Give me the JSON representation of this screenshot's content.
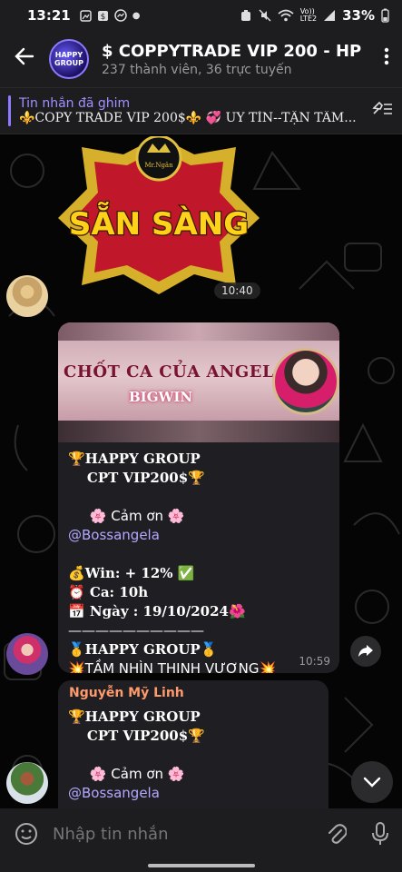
{
  "status_bar": {
    "time": "13:21",
    "network": "Vo))\nLTE2",
    "battery": "33%"
  },
  "header": {
    "title": "$ COPPYTRADE VIP 200 - HP",
    "subtitle": "237 thành viên, 36 trực tuyến",
    "avatar_text_1": "HAPPY",
    "avatar_text_2": "GROUP"
  },
  "pinned": {
    "label": "Tin nhắn đã ghim",
    "message": "⚜️COPY TRADE VIP 200$⚜️     💞 UY TÍN--TẬN TÂM..."
  },
  "sticker": {
    "text": "SẴN SÀNG",
    "sign": "Mr.Ngân",
    "time": "10:40"
  },
  "message1": {
    "banner_title": "CHỐT CA CỦA ANGELA",
    "banner_sub": "BIGWIN",
    "lines": [
      "🏆HAPPY GROUP",
      "    CPT VIP200$🏆",
      "",
      "     🌸 Cảm ơn 🌸",
      "@Bossangela",
      "",
      "💰Win: + 12% ✅",
      "⏰ Ca: 10h",
      "📅 Ngày : 19/10/2024🌺",
      "——————————",
      "🥇HAPPY GROUP🥇",
      "💥TẦM NHÌN THỊNH VƯỢNG💥"
    ],
    "time": "10:59"
  },
  "message2": {
    "sender": "Nguyễn Mỹ Linh",
    "lines": [
      "🏆HAPPY GROUP",
      "    CPT VIP200$🏆",
      "",
      "     🌸 Cảm ơn 🌸",
      "@Bossangela"
    ]
  },
  "input": {
    "placeholder": "Nhập tin nhắn"
  },
  "colors": {
    "accent": "#8d7cff",
    "mention": "#b3a8ff",
    "sender": "#ff9a6b",
    "bubble": "#1f1e23"
  }
}
